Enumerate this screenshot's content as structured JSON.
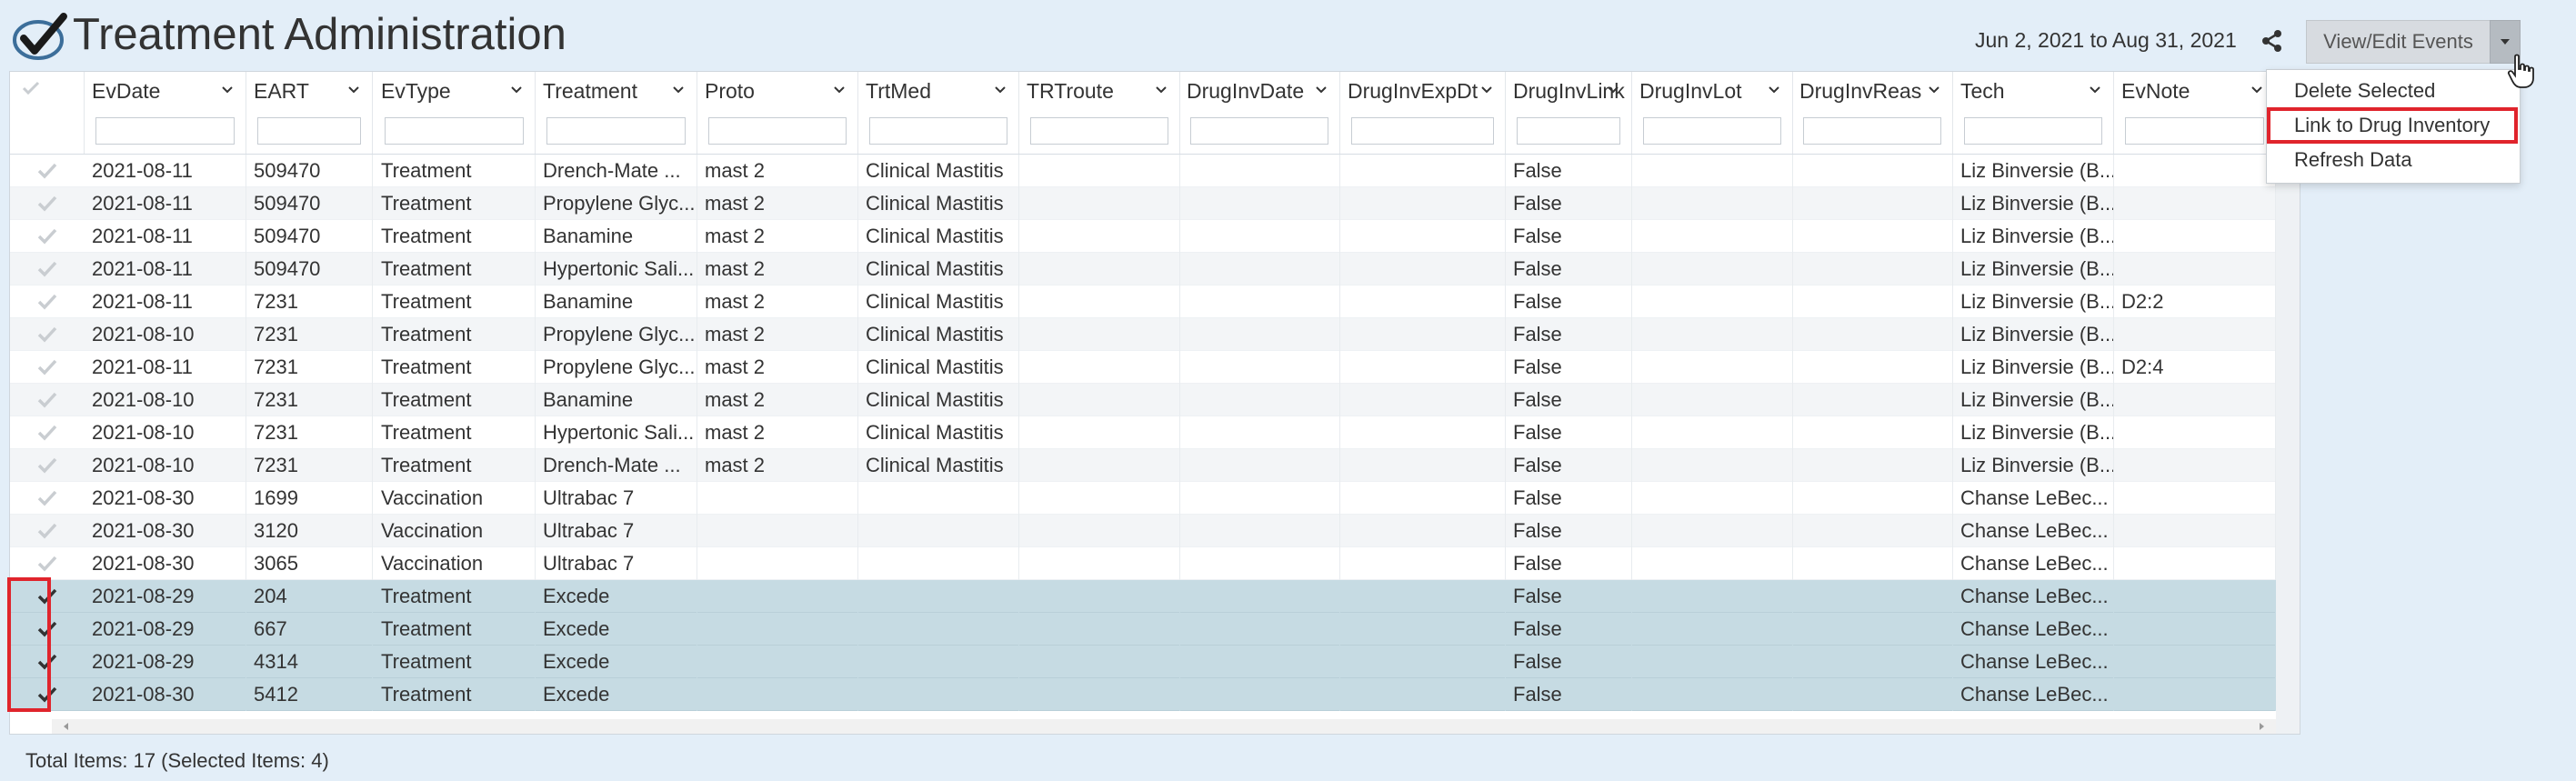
{
  "header": {
    "title": "Treatment Administration",
    "date_range": "Jun 2, 2021 to Aug 31, 2021",
    "view_edit_label": "View/Edit Events"
  },
  "dropdown": {
    "items": [
      {
        "label": "Delete Selected"
      },
      {
        "label": "Link to Drug Inventory",
        "highlighted": true
      },
      {
        "label": "Refresh Data"
      }
    ]
  },
  "columns": [
    {
      "key": "evdate",
      "label": "EvDate"
    },
    {
      "key": "eart",
      "label": "EART"
    },
    {
      "key": "evtype",
      "label": "EvType"
    },
    {
      "key": "treatment",
      "label": "Treatment"
    },
    {
      "key": "proto",
      "label": "Proto"
    },
    {
      "key": "trtmed",
      "label": "TrtMed"
    },
    {
      "key": "trtroute",
      "label": "TRTroute"
    },
    {
      "key": "druginvdate",
      "label": "DrugInvDate"
    },
    {
      "key": "druginvexpdt",
      "label": "DrugInvExpDt"
    },
    {
      "key": "druginvlink",
      "label": "DrugInvLink"
    },
    {
      "key": "druginvlot",
      "label": "DrugInvLot"
    },
    {
      "key": "druginvreas",
      "label": "DrugInvReas"
    },
    {
      "key": "tech",
      "label": "Tech"
    },
    {
      "key": "evnote",
      "label": "EvNote"
    }
  ],
  "rows": [
    {
      "selected": false,
      "evdate": "2021-08-11",
      "eart": "509470",
      "evtype": "Treatment",
      "treatment": "Drench-Mate ...",
      "proto": "mast 2",
      "trtmed": "Clinical Mastitis",
      "trtroute": "",
      "druginvdate": "",
      "druginvexpdt": "",
      "druginvlink": "False",
      "druginvlot": "",
      "druginvreas": "",
      "tech": "Liz Binversie (B...",
      "evnote": ""
    },
    {
      "selected": false,
      "evdate": "2021-08-11",
      "eart": "509470",
      "evtype": "Treatment",
      "treatment": "Propylene Glyc...",
      "proto": "mast 2",
      "trtmed": "Clinical Mastitis",
      "trtroute": "",
      "druginvdate": "",
      "druginvexpdt": "",
      "druginvlink": "False",
      "druginvlot": "",
      "druginvreas": "",
      "tech": "Liz Binversie (B...",
      "evnote": ""
    },
    {
      "selected": false,
      "evdate": "2021-08-11",
      "eart": "509470",
      "evtype": "Treatment",
      "treatment": "Banamine",
      "proto": "mast 2",
      "trtmed": "Clinical Mastitis",
      "trtroute": "",
      "druginvdate": "",
      "druginvexpdt": "",
      "druginvlink": "False",
      "druginvlot": "",
      "druginvreas": "",
      "tech": "Liz Binversie (B...",
      "evnote": ""
    },
    {
      "selected": false,
      "evdate": "2021-08-11",
      "eart": "509470",
      "evtype": "Treatment",
      "treatment": "Hypertonic Sali...",
      "proto": "mast 2",
      "trtmed": "Clinical Mastitis",
      "trtroute": "",
      "druginvdate": "",
      "druginvexpdt": "",
      "druginvlink": "False",
      "druginvlot": "",
      "druginvreas": "",
      "tech": "Liz Binversie (B...",
      "evnote": ""
    },
    {
      "selected": false,
      "evdate": "2021-08-11",
      "eart": "7231",
      "evtype": "Treatment",
      "treatment": "Banamine",
      "proto": "mast 2",
      "trtmed": "Clinical Mastitis",
      "trtroute": "",
      "druginvdate": "",
      "druginvexpdt": "",
      "druginvlink": "False",
      "druginvlot": "",
      "druginvreas": "",
      "tech": "Liz Binversie (B...",
      "evnote": "D2:2"
    },
    {
      "selected": false,
      "evdate": "2021-08-10",
      "eart": "7231",
      "evtype": "Treatment",
      "treatment": "Propylene Glyc...",
      "proto": "mast 2",
      "trtmed": "Clinical Mastitis",
      "trtroute": "",
      "druginvdate": "",
      "druginvexpdt": "",
      "druginvlink": "False",
      "druginvlot": "",
      "druginvreas": "",
      "tech": "Liz Binversie (B...",
      "evnote": ""
    },
    {
      "selected": false,
      "evdate": "2021-08-11",
      "eart": "7231",
      "evtype": "Treatment",
      "treatment": "Propylene Glyc...",
      "proto": "mast 2",
      "trtmed": "Clinical Mastitis",
      "trtroute": "",
      "druginvdate": "",
      "druginvexpdt": "",
      "druginvlink": "False",
      "druginvlot": "",
      "druginvreas": "",
      "tech": "Liz Binversie (B...",
      "evnote": "D2:4"
    },
    {
      "selected": false,
      "evdate": "2021-08-10",
      "eart": "7231",
      "evtype": "Treatment",
      "treatment": "Banamine",
      "proto": "mast 2",
      "trtmed": "Clinical Mastitis",
      "trtroute": "",
      "druginvdate": "",
      "druginvexpdt": "",
      "druginvlink": "False",
      "druginvlot": "",
      "druginvreas": "",
      "tech": "Liz Binversie (B...",
      "evnote": ""
    },
    {
      "selected": false,
      "evdate": "2021-08-10",
      "eart": "7231",
      "evtype": "Treatment",
      "treatment": "Hypertonic Sali...",
      "proto": "mast 2",
      "trtmed": "Clinical Mastitis",
      "trtroute": "",
      "druginvdate": "",
      "druginvexpdt": "",
      "druginvlink": "False",
      "druginvlot": "",
      "druginvreas": "",
      "tech": "Liz Binversie (B...",
      "evnote": ""
    },
    {
      "selected": false,
      "evdate": "2021-08-10",
      "eart": "7231",
      "evtype": "Treatment",
      "treatment": "Drench-Mate ...",
      "proto": "mast 2",
      "trtmed": "Clinical Mastitis",
      "trtroute": "",
      "druginvdate": "",
      "druginvexpdt": "",
      "druginvlink": "False",
      "druginvlot": "",
      "druginvreas": "",
      "tech": "Liz Binversie (B...",
      "evnote": ""
    },
    {
      "selected": false,
      "evdate": "2021-08-30",
      "eart": "1699",
      "evtype": "Vaccination",
      "treatment": "Ultrabac 7",
      "proto": "",
      "trtmed": "",
      "trtroute": "",
      "druginvdate": "",
      "druginvexpdt": "",
      "druginvlink": "False",
      "druginvlot": "",
      "druginvreas": "",
      "tech": "Chanse LeBec...",
      "evnote": ""
    },
    {
      "selected": false,
      "evdate": "2021-08-30",
      "eart": "3120",
      "evtype": "Vaccination",
      "treatment": "Ultrabac 7",
      "proto": "",
      "trtmed": "",
      "trtroute": "",
      "druginvdate": "",
      "druginvexpdt": "",
      "druginvlink": "False",
      "druginvlot": "",
      "druginvreas": "",
      "tech": "Chanse LeBec...",
      "evnote": ""
    },
    {
      "selected": false,
      "evdate": "2021-08-30",
      "eart": "3065",
      "evtype": "Vaccination",
      "treatment": "Ultrabac 7",
      "proto": "",
      "trtmed": "",
      "trtroute": "",
      "druginvdate": "",
      "druginvexpdt": "",
      "druginvlink": "False",
      "druginvlot": "",
      "druginvreas": "",
      "tech": "Chanse LeBec...",
      "evnote": ""
    },
    {
      "selected": true,
      "evdate": "2021-08-29",
      "eart": "204",
      "evtype": "Treatment",
      "treatment": "Excede",
      "proto": "",
      "trtmed": "",
      "trtroute": "",
      "druginvdate": "",
      "druginvexpdt": "",
      "druginvlink": "False",
      "druginvlot": "",
      "druginvreas": "",
      "tech": "Chanse LeBec...",
      "evnote": ""
    },
    {
      "selected": true,
      "evdate": "2021-08-29",
      "eart": "667",
      "evtype": "Treatment",
      "treatment": "Excede",
      "proto": "",
      "trtmed": "",
      "trtroute": "",
      "druginvdate": "",
      "druginvexpdt": "",
      "druginvlink": "False",
      "druginvlot": "",
      "druginvreas": "",
      "tech": "Chanse LeBec...",
      "evnote": ""
    },
    {
      "selected": true,
      "evdate": "2021-08-29",
      "eart": "4314",
      "evtype": "Treatment",
      "treatment": "Excede",
      "proto": "",
      "trtmed": "",
      "trtroute": "",
      "druginvdate": "",
      "druginvexpdt": "",
      "druginvlink": "False",
      "druginvlot": "",
      "druginvreas": "",
      "tech": "Chanse LeBec...",
      "evnote": ""
    },
    {
      "selected": true,
      "evdate": "2021-08-30",
      "eart": "5412",
      "evtype": "Treatment",
      "treatment": "Excede",
      "proto": "",
      "trtmed": "",
      "trtroute": "",
      "druginvdate": "",
      "druginvexpdt": "",
      "druginvlink": "False",
      "druginvlot": "",
      "druginvreas": "",
      "tech": "Chanse LeBec...",
      "evnote": ""
    }
  ],
  "footer": {
    "summary": "Total Items: 17 (Selected Items: 4)"
  },
  "colors": {
    "page_bg": "#e3eef8",
    "selected_row": "#c6dbe3",
    "highlight_red": "#e0242c",
    "button_bg": "#d7dbe0"
  }
}
